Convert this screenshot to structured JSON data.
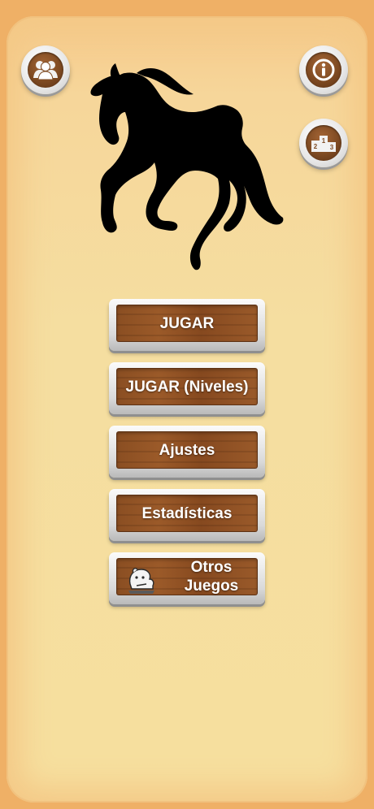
{
  "menu": {
    "play_label": "JUGAR",
    "play_levels_label": "JUGAR (Niveles)",
    "settings_label": "Ajustes",
    "stats_label": "Estadísticas",
    "other_games_line1": "Otros",
    "other_games_line2": "Juegos"
  },
  "icons": {
    "top_left": "users-icon",
    "top_right": "info-icon",
    "ranking": "podium-icon",
    "logo": "horse-silhouette"
  },
  "podium": {
    "first": "1",
    "second": "2",
    "third": "3"
  },
  "colors": {
    "background": "#efb066",
    "panel": "#f6df9e",
    "wood": "#8a4e22",
    "button_frame": "#d9d9d9",
    "label_text": "#ffffff"
  }
}
